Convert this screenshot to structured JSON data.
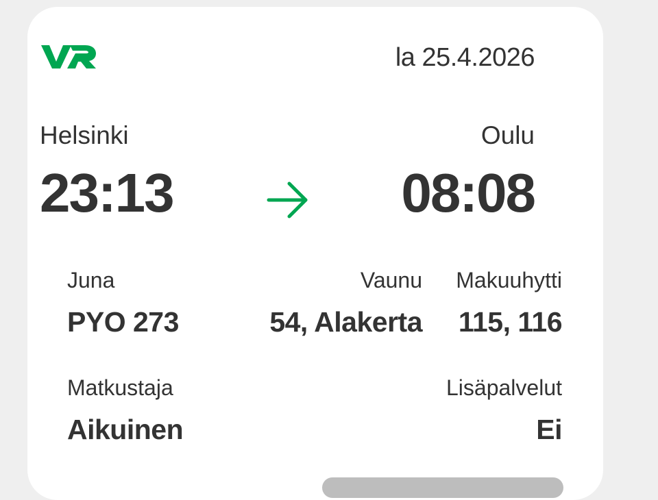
{
  "header": {
    "logo_text": "VR",
    "date": "la 25.4.2026"
  },
  "route": {
    "origin": {
      "city": "Helsinki",
      "time": "23:13"
    },
    "destination": {
      "city": "Oulu",
      "time": "08:08"
    },
    "arrow_icon": "arrow-right-icon"
  },
  "details": {
    "train": {
      "label": "Juna",
      "value": "PYO 273"
    },
    "car": {
      "label": "Vaunu",
      "value": "54, Alakerta"
    },
    "cabin": {
      "label": "Makuuhytti",
      "value": "115, 116"
    },
    "passenger": {
      "label": "Matkustaja",
      "value": "Aikuinen"
    },
    "extras": {
      "label": "Lisäpalvelut",
      "value": "Ei"
    }
  },
  "colors": {
    "brand_green": "#00A651",
    "text": "#333333",
    "card": "#FFFFFF",
    "background": "#EFEFEF"
  }
}
